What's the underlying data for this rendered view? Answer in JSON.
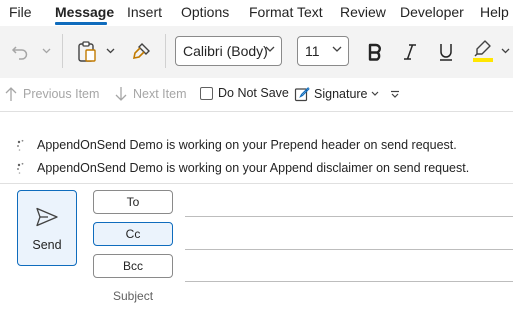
{
  "menu": {
    "tabs": [
      "File",
      "Message",
      "Insert",
      "Options",
      "Format Text",
      "Review",
      "Developer",
      "Help"
    ],
    "active_tab": "Message"
  },
  "ribbon": {
    "font_name": "Calibri (Body)",
    "font_size": "11",
    "highlight_color": "#ffe600",
    "accent_color": "#0f6cbd"
  },
  "commands": {
    "previous_item": "Previous Item",
    "next_item": "Next Item",
    "do_not_save": "Do Not Save",
    "signature": "Signature"
  },
  "notifications": [
    "AppendOnSend Demo is working on your Prepend header on send request.",
    "AppendOnSend Demo is working on your Append disclaimer on send request."
  ],
  "compose": {
    "send_label": "Send",
    "to_label": "To",
    "cc_label": "Cc",
    "bcc_label": "Bcc",
    "subject_label": "Subject"
  },
  "icons": [
    "undo-icon",
    "paste-icon",
    "format-painter-icon",
    "bold-icon",
    "italic-icon",
    "underline-icon",
    "highlighter-icon",
    "arrow-up-icon",
    "arrow-down-icon",
    "signature-icon",
    "overflow-chevron-icon",
    "spinner-icon",
    "send-icon"
  ]
}
